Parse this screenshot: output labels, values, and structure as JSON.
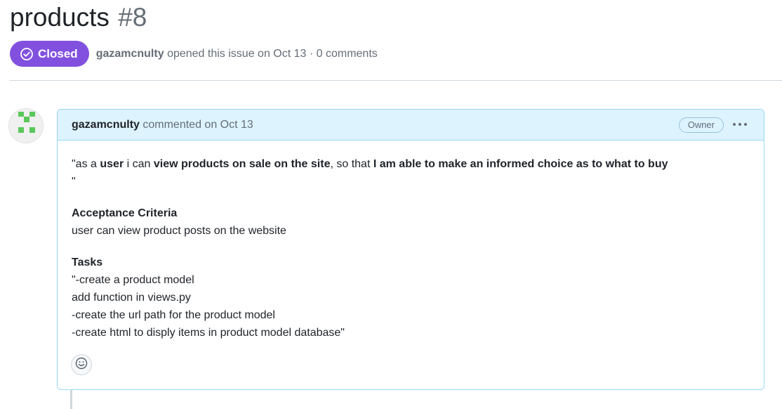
{
  "issue": {
    "title": "products",
    "number": "#8",
    "state": "Closed",
    "author": "gazamcnulty",
    "opened_text": "opened this issue on Oct 13 · 0 comments"
  },
  "comment": {
    "author": "gazamcnulty",
    "action_text": "commented on Oct 13",
    "role_badge": "Owner",
    "menu_icon": "kebab-horizontal-icon",
    "reaction_icon": "smiley-icon",
    "body": {
      "story_parts": [
        "\"as a ",
        "user",
        " i can ",
        "view products on sale on the site",
        ", so that ",
        "I am able to make an informed choice as to what to buy"
      ],
      "story_close": "\"",
      "acceptance_heading": "Acceptance Criteria",
      "acceptance_text": "user can view product posts on the website",
      "tasks_heading": "Tasks",
      "tasks_lines": [
        "\"-create a product model",
        "add function in views.py",
        "-create the url path for the product model",
        "-create html to disply items in product model database\""
      ]
    }
  },
  "colors": {
    "closed_badge": "#8250df",
    "header_bg": "#ddf4ff",
    "header_border": "#9cd8f5",
    "avatar_green": "#5ac85a"
  }
}
